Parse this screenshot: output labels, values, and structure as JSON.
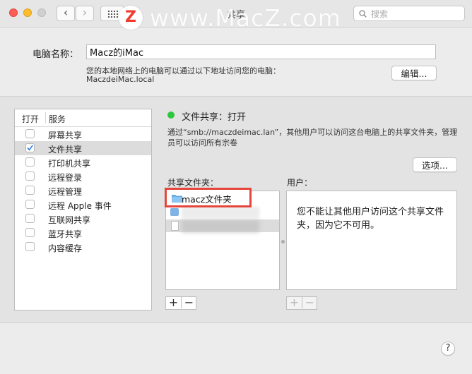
{
  "window": {
    "title": "共享"
  },
  "toolbar": {
    "back_label": "‹",
    "forward_label": "›",
    "search_placeholder": "搜索"
  },
  "watermark": {
    "logo_letter": "Z",
    "text": "www.MacZ.com"
  },
  "computer": {
    "name_label": "电脑名称：",
    "name_value": "Macz的iMac",
    "address_info": "您的本地网络上的电脑可以通过以下地址访问您的电脑：",
    "hostname": "MaczdeiMac.local",
    "edit_label": "编辑..."
  },
  "services": {
    "col_open": "打开",
    "col_service": "服务",
    "items": [
      {
        "label": "屏幕共享",
        "checked": false
      },
      {
        "label": "文件共享",
        "checked": true,
        "selected": true
      },
      {
        "label": "打印机共享",
        "checked": false
      },
      {
        "label": "远程登录",
        "checked": false
      },
      {
        "label": "远程管理",
        "checked": false
      },
      {
        "label": "远程 Apple 事件",
        "checked": false
      },
      {
        "label": "互联网共享",
        "checked": false
      },
      {
        "label": "蓝牙共享",
        "checked": false
      },
      {
        "label": "内容缓存",
        "checked": false
      }
    ]
  },
  "file_sharing": {
    "status": "文件共享：打开",
    "status_color": "#2ec73d",
    "description": "通过“smb://maczdeimac.lan”，其他用户可以访问这台电脑上的共享文件夹，管理员可以访问所有宗卷",
    "options_label": "选项...",
    "shared_folders_label": "共享文件夹：",
    "users_label": "用户：",
    "folders": [
      {
        "name": "macz文件夹"
      }
    ],
    "users_message": "您不能让其他用户访问这个共享文件夹，因为它不可用。",
    "add_label": "+",
    "remove_label": "−"
  },
  "help_label": "?"
}
